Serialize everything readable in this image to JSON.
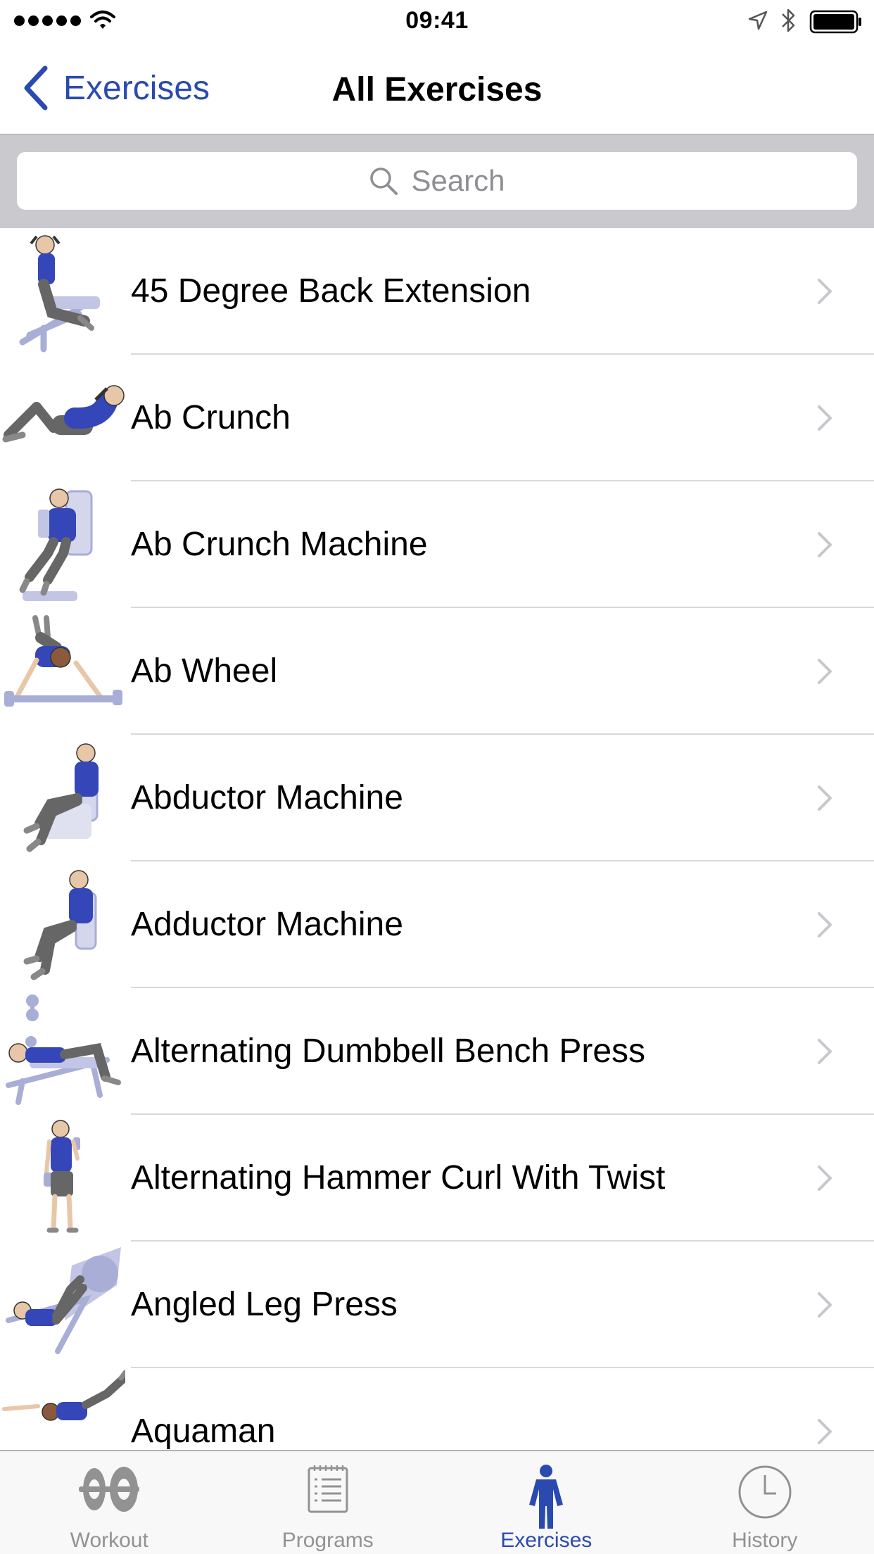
{
  "status_bar": {
    "time": "09:41"
  },
  "nav": {
    "back_label": "Exercises",
    "title": "All Exercises"
  },
  "search": {
    "placeholder": "Search"
  },
  "exercises": [
    {
      "label": "45 Degree Back Extension"
    },
    {
      "label": "Ab Crunch"
    },
    {
      "label": "Ab Crunch Machine"
    },
    {
      "label": "Ab Wheel"
    },
    {
      "label": "Abductor Machine"
    },
    {
      "label": "Adductor Machine"
    },
    {
      "label": "Alternating Dumbbell Bench Press"
    },
    {
      "label": "Alternating Hammer Curl With Twist"
    },
    {
      "label": "Angled Leg Press"
    },
    {
      "label": "Aquaman"
    }
  ],
  "tabs": [
    {
      "label": "Workout",
      "icon": "workout-icon",
      "active": false
    },
    {
      "label": "Programs",
      "icon": "programs-icon",
      "active": false
    },
    {
      "label": "Exercises",
      "icon": "exercises-icon",
      "active": true
    },
    {
      "label": "History",
      "icon": "history-icon",
      "active": false
    }
  ],
  "colors": {
    "accent": "#2a4ab0",
    "shirt": "#3446b8",
    "equipment": "#a8aed6",
    "tab_inactive": "#929292",
    "search_bg": "#c9c9ce"
  }
}
